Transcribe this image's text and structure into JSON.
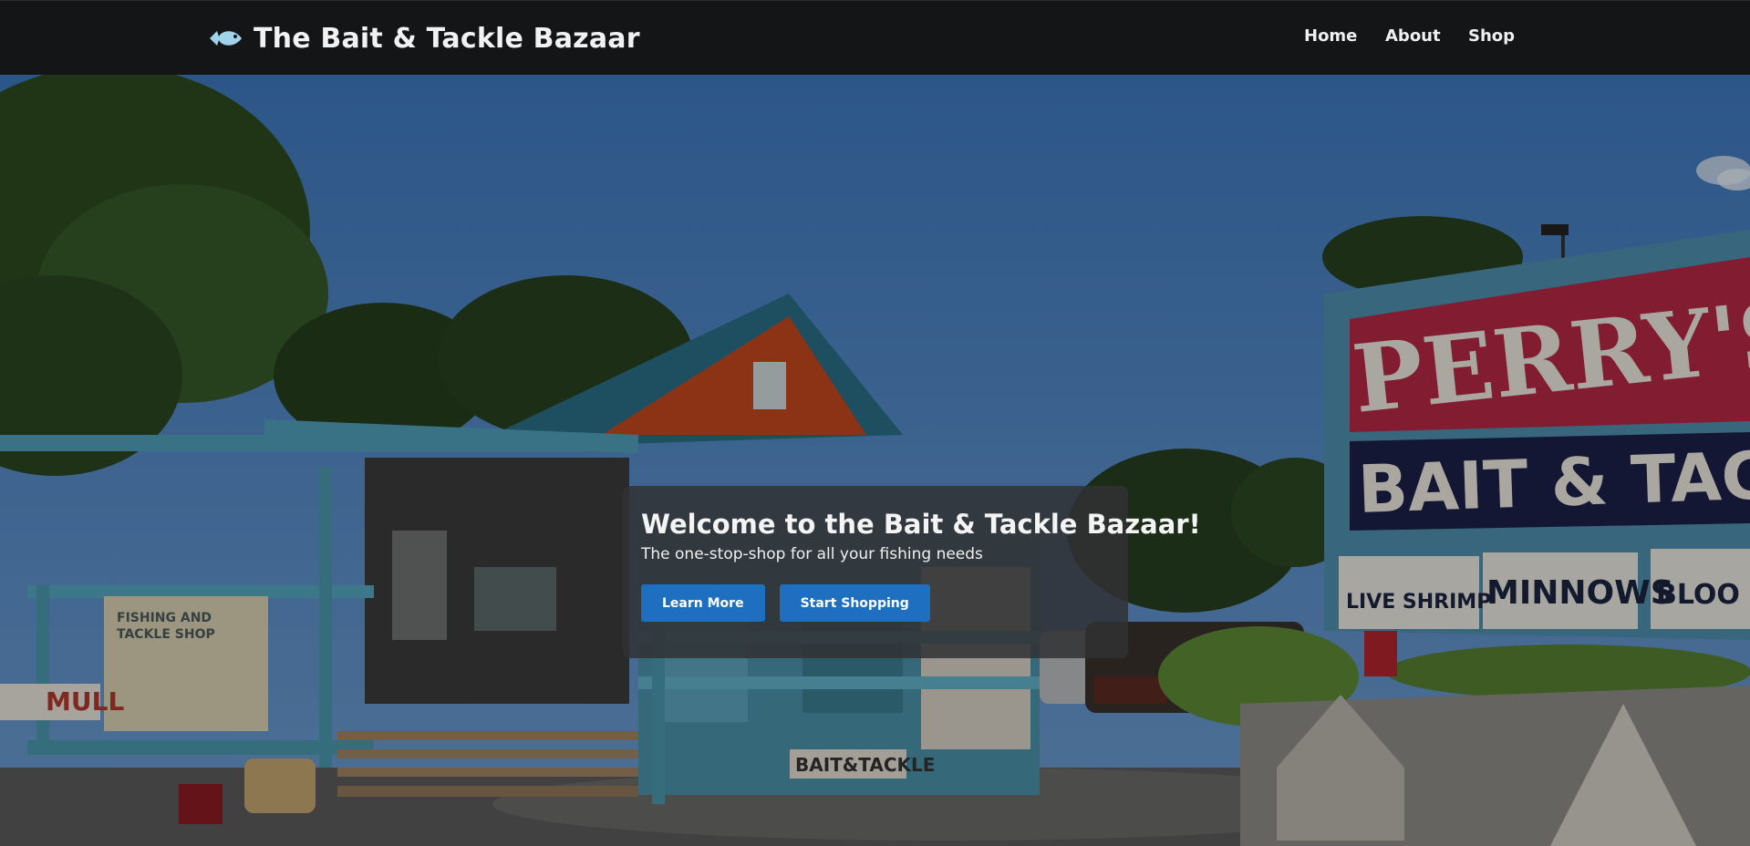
{
  "brand": {
    "name": "The Bait & Tackle Bazaar",
    "icon": "fish-icon"
  },
  "nav": {
    "items": [
      {
        "label": "Home"
      },
      {
        "label": "About"
      },
      {
        "label": "Shop"
      }
    ]
  },
  "hero": {
    "title": "Welcome to the Bait & Tackle Bazaar!",
    "subtitle": "The one-stop-shop for all your fishing needs",
    "buttons": [
      {
        "label": "Learn More"
      },
      {
        "label": "Start Shopping"
      }
    ]
  },
  "photo": {
    "sign_lines": [
      "PERRY'S",
      "BAIT & TACKL",
      "LIVE SHRIMP",
      "MINNOWS",
      "BLOO WOR"
    ],
    "banner": [
      "FISHING AND",
      "TACKLE SHOP"
    ],
    "small_sign": "BAIT&TACKLE",
    "mullet_sign": "MULL"
  },
  "colors": {
    "navbar": "#141517",
    "accent_button": "#1e6fc0",
    "sky": "#4f86c4"
  }
}
